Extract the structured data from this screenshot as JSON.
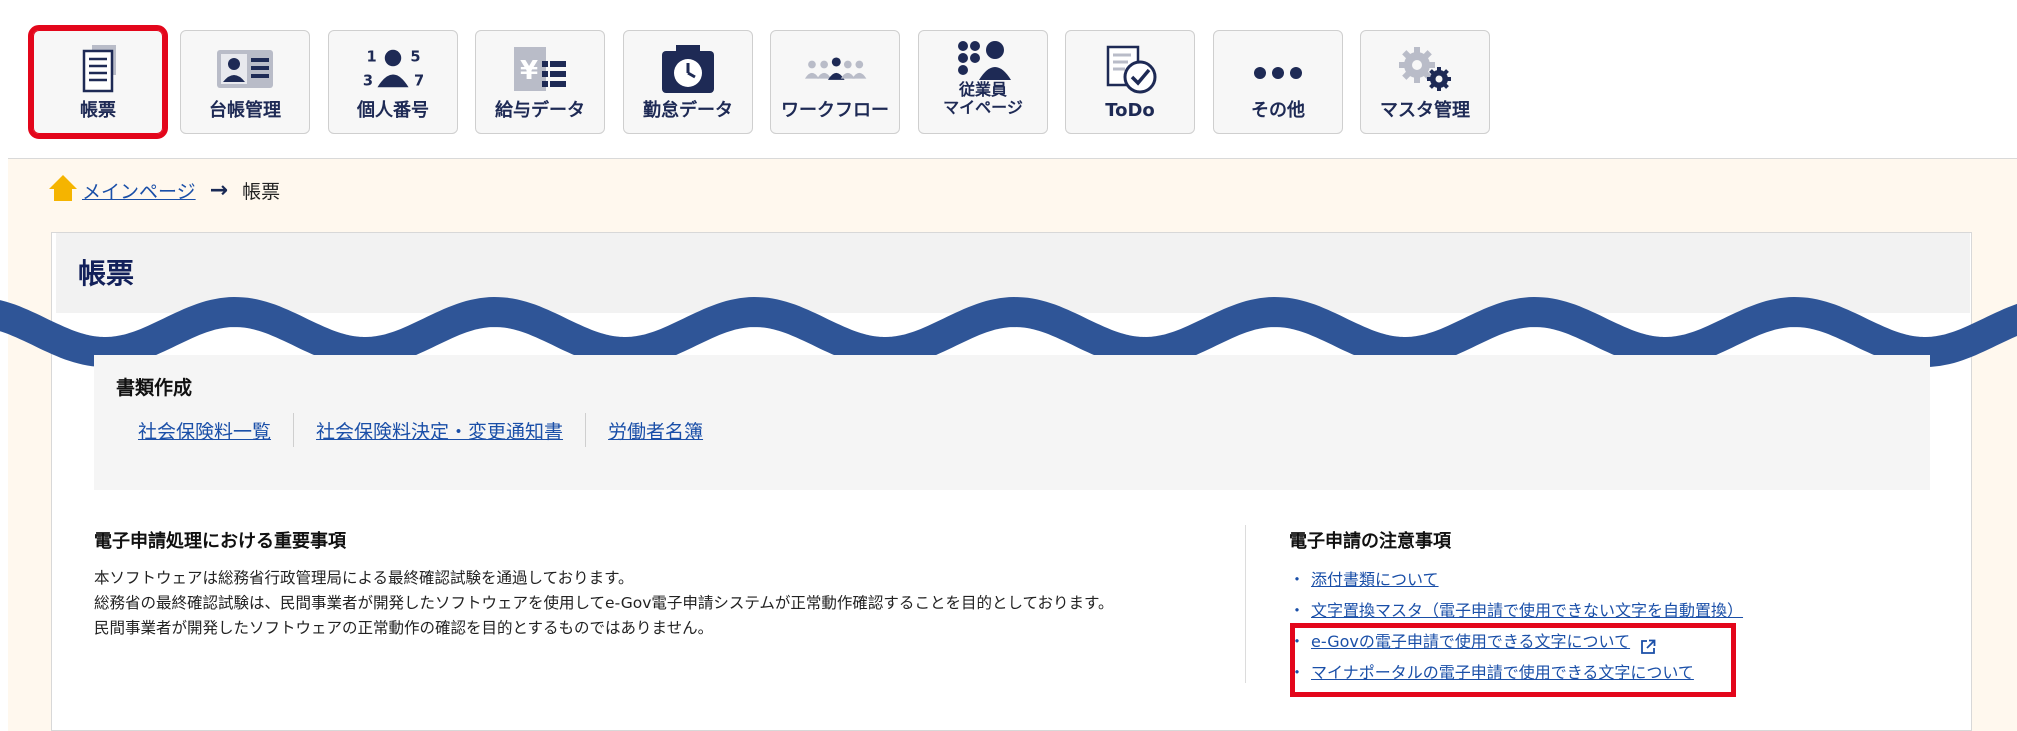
{
  "toolbar": {
    "buttons": [
      {
        "label": "帳票",
        "icon": "document-list-icon"
      },
      {
        "label": "台帳管理",
        "icon": "id-card-icon"
      },
      {
        "label": "個人番号",
        "icon": "person-number-icon"
      },
      {
        "label": "給与データ",
        "icon": "salary-yen-icon"
      },
      {
        "label": "勤怠データ",
        "icon": "timecard-clock-icon"
      },
      {
        "label": "ワークフロー",
        "icon": "workflow-people-icon"
      },
      {
        "label_line1": "従業員",
        "label_line2": "マイページ",
        "icon": "employee-mypage-icon"
      },
      {
        "label": "ToDo",
        "icon": "todo-check-icon"
      },
      {
        "label": "その他",
        "icon": "more-dots-icon"
      },
      {
        "label": "マスタ管理",
        "icon": "gear-icon"
      }
    ]
  },
  "breadcrumb": {
    "home_label": "メインページ",
    "current": "帳票"
  },
  "page": {
    "title": "帳票"
  },
  "documents": {
    "section_title": "書類作成",
    "links": [
      "社会保険料一覧",
      "社会保険料決定・変更通知書",
      "労働者名簿"
    ]
  },
  "important": {
    "title": "電子申請処理における重要事項",
    "lines": [
      "本ソフトウェアは総務省行政管理局による最終確認試験を通過しております。",
      "総務省の最終確認試験は、民間事業者が開発したソフトウェアを使用してe-Gov電子申請システムが正常動作確認することを目的としております。",
      "民間事業者が開発したソフトウェアの正常動作の確認を目的とするものではありません。"
    ]
  },
  "notes": {
    "title": "電子申請の注意事項",
    "bullet": "・",
    "links": [
      "添付書類について",
      "文字置換マスタ（電子申請で使用できない文字を自動置換）",
      "e-Govの電子申請で使用できる文字について",
      "マイナポータルの電子申請で使用できる文字について"
    ]
  },
  "colors": {
    "navy": "#1e2a55",
    "link": "#1a4fa8",
    "highlight": "#e3061b",
    "wave": "#2f5597",
    "beige": "#fff8ee"
  }
}
